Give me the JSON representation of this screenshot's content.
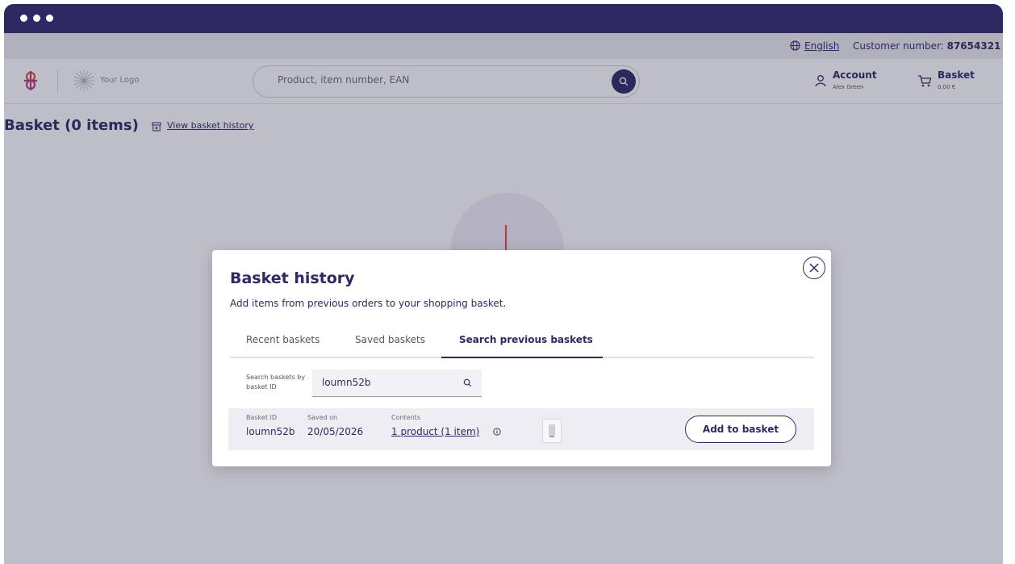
{
  "topbar": {
    "language": "English",
    "customer_label": "Customer number:",
    "customer_number": "87654321"
  },
  "header": {
    "logo_text": "Your Logo",
    "search_placeholder": "Product, item number, EAN",
    "account_title": "Account",
    "account_user": "Alex Green",
    "basket_title": "Basket",
    "basket_total": "0,00 €"
  },
  "page": {
    "heading": "Basket (0 items)",
    "history_link": "View basket history"
  },
  "modal": {
    "title": "Basket history",
    "subtitle": "Add items from previous orders to your shopping basket.",
    "tabs": [
      {
        "label": "Recent baskets"
      },
      {
        "label": "Saved baskets"
      },
      {
        "label": "Search previous baskets"
      }
    ],
    "search_label": "Search baskets by basket ID",
    "search_value": "loumn52b",
    "result": {
      "id_label": "Basket ID",
      "id_value": "loumn52b",
      "saved_label": "Saved on",
      "saved_value": "20/05/2026",
      "contents_label": "Contents",
      "contents_value": "1 product (1 item)",
      "add_label": "Add to basket"
    }
  },
  "colors": {
    "primary": "#2c2a61",
    "brand_red": "#e8503a",
    "brand_purple": "#b03a9a"
  }
}
